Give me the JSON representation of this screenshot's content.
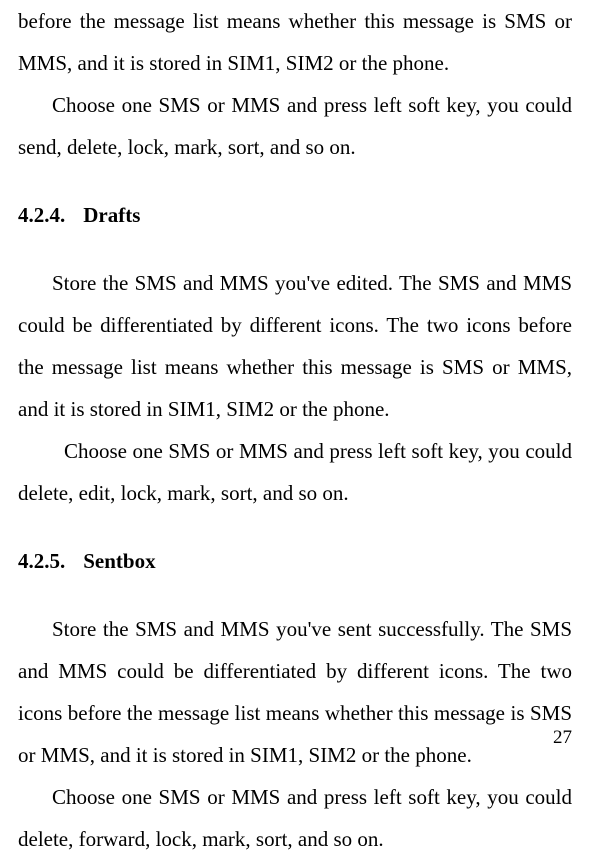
{
  "para1a": "before the message list means whether this message is SMS or MMS, and it is stored in SIM1, SIM2 or the phone.",
  "para1b": "Choose one SMS or MMS and press left soft key, you could send, delete, lock, mark, sort, and so on.",
  "heading1_num": "4.2.4.",
  "heading1_title": "Drafts",
  "para2a": "Store the SMS and MMS you've edited. The SMS and MMS could be differentiated by different icons. The two icons before the message list means whether this message is SMS or MMS, and it is stored in SIM1, SIM2 or the phone.",
  "para2b": "Choose one SMS or MMS and press left soft key, you could delete, edit, lock, mark, sort, and so on.",
  "heading2_num": "4.2.5.",
  "heading2_title": "Sentbox",
  "para3a": "Store the SMS and MMS you've sent successfully. The SMS and MMS could be differentiated by different icons. The two icons before the message list means whether this message is SMS or MMS, and it is stored in SIM1, SIM2 or the phone.",
  "para3b": "Choose one SMS or MMS and press left soft key, you could delete, forward, lock, mark, sort, and so on.",
  "page_number": "27"
}
